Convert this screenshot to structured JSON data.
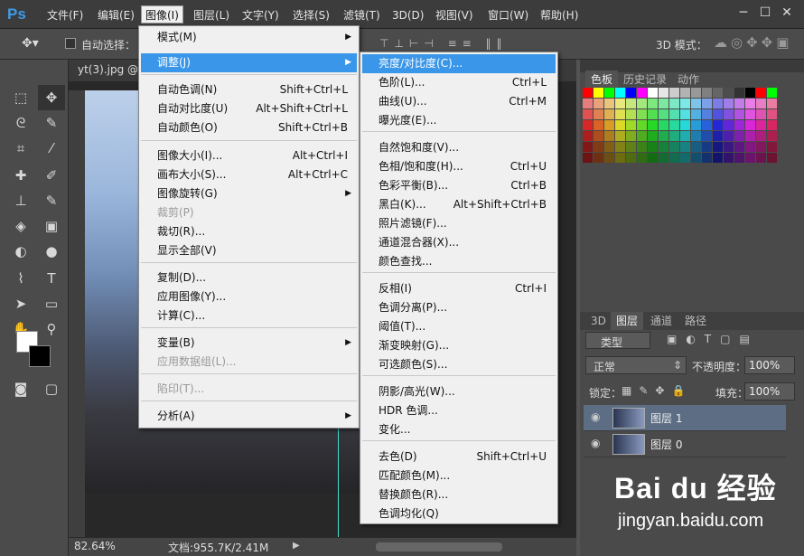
{
  "app": {
    "logo": "Ps"
  },
  "menubar": [
    "文件(F)",
    "编辑(E)",
    "图像(I)",
    "图层(L)",
    "文字(Y)",
    "选择(S)",
    "滤镜(T)",
    "3D(D)",
    "视图(V)",
    "窗口(W)",
    "帮助(H)"
  ],
  "window": {
    "min": "─",
    "max": "☐",
    "close": "✕"
  },
  "options": {
    "auto_select": "自动选择：",
    "mode_3d": "3D 模式："
  },
  "document": {
    "tab": "yt(3).jpg @",
    "zoom": "82.64%",
    "doc_info": "文档:955.7K/2.41M"
  },
  "image_menu": [
    {
      "label": "模式(M)",
      "shortcut": "",
      "sub": true
    },
    {
      "label": "调整(J)",
      "shortcut": "",
      "sub": true,
      "hl": true
    },
    {
      "label": "自动色调(N)",
      "shortcut": "Shift+Ctrl+L"
    },
    {
      "label": "自动对比度(U)",
      "shortcut": "Alt+Shift+Ctrl+L"
    },
    {
      "label": "自动颜色(O)",
      "shortcut": "Shift+Ctrl+B"
    },
    {
      "label": "图像大小(I)...",
      "shortcut": "Alt+Ctrl+I"
    },
    {
      "label": "画布大小(S)...",
      "shortcut": "Alt+Ctrl+C"
    },
    {
      "label": "图像旋转(G)",
      "shortcut": "",
      "sub": true
    },
    {
      "label": "裁剪(P)",
      "shortcut": "",
      "dis": true
    },
    {
      "label": "裁切(R)...",
      "shortcut": ""
    },
    {
      "label": "显示全部(V)",
      "shortcut": ""
    },
    {
      "label": "复制(D)...",
      "shortcut": ""
    },
    {
      "label": "应用图像(Y)...",
      "shortcut": ""
    },
    {
      "label": "计算(C)...",
      "shortcut": ""
    },
    {
      "label": "变量(B)",
      "shortcut": "",
      "sub": true
    },
    {
      "label": "应用数据组(L)...",
      "shortcut": "",
      "dis": true
    },
    {
      "label": "陷印(T)...",
      "shortcut": "",
      "dis": true
    },
    {
      "label": "分析(A)",
      "shortcut": "",
      "sub": true
    }
  ],
  "adjust_menu": [
    {
      "label": "亮度/对比度(C)...",
      "shortcut": "",
      "hl": true
    },
    {
      "label": "色阶(L)...",
      "shortcut": "Ctrl+L"
    },
    {
      "label": "曲线(U)...",
      "shortcut": "Ctrl+M"
    },
    {
      "label": "曝光度(E)...",
      "shortcut": ""
    },
    {
      "label": "自然饱和度(V)...",
      "shortcut": ""
    },
    {
      "label": "色相/饱和度(H)...",
      "shortcut": "Ctrl+U"
    },
    {
      "label": "色彩平衡(B)...",
      "shortcut": "Ctrl+B"
    },
    {
      "label": "黑白(K)...",
      "shortcut": "Alt+Shift+Ctrl+B"
    },
    {
      "label": "照片滤镜(F)...",
      "shortcut": ""
    },
    {
      "label": "通道混合器(X)...",
      "shortcut": ""
    },
    {
      "label": "颜色查找...",
      "shortcut": ""
    },
    {
      "label": "反相(I)",
      "shortcut": "Ctrl+I"
    },
    {
      "label": "色调分离(P)...",
      "shortcut": ""
    },
    {
      "label": "阈值(T)...",
      "shortcut": ""
    },
    {
      "label": "渐变映射(G)...",
      "shortcut": ""
    },
    {
      "label": "可选颜色(S)...",
      "shortcut": ""
    },
    {
      "label": "阴影/高光(W)...",
      "shortcut": ""
    },
    {
      "label": "HDR 色调...",
      "shortcut": ""
    },
    {
      "label": "变化...",
      "shortcut": ""
    },
    {
      "label": "去色(D)",
      "shortcut": "Shift+Ctrl+U"
    },
    {
      "label": "匹配颜色(M)...",
      "shortcut": ""
    },
    {
      "label": "替换颜色(R)...",
      "shortcut": ""
    },
    {
      "label": "色调均化(Q)",
      "shortcut": ""
    }
  ],
  "panels": {
    "tabs_top": [
      "色板",
      "历史记录",
      "动作"
    ],
    "tabs_layers": [
      "3D",
      "图层",
      "通道",
      "路径"
    ],
    "kind": "类型",
    "blend": "正常",
    "opacity_label": "不透明度：",
    "opacity": "100%",
    "lock_label": "锁定：",
    "fill_label": "填充：",
    "fill": "100%",
    "layers": [
      "图层 1",
      "图层 0"
    ]
  },
  "watermark": {
    "brand": "Bai du 经验",
    "url": "jingyan.baidu.com"
  }
}
